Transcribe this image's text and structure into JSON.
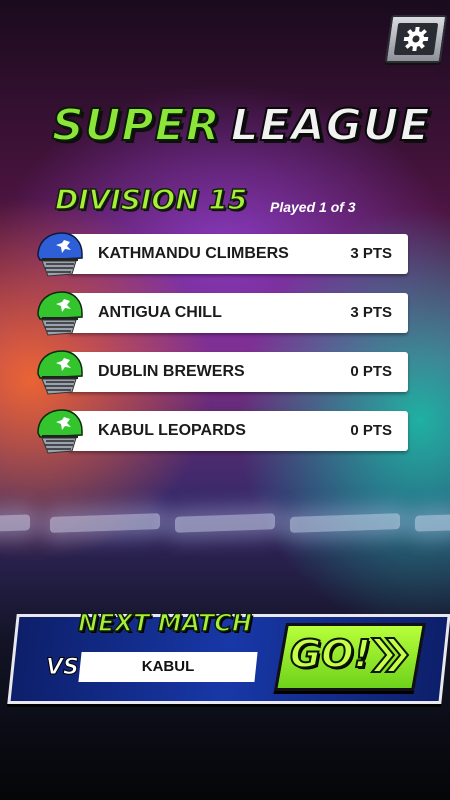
{
  "header": {
    "title_word1": "SUPER",
    "title_word2": "LEAGUE",
    "settings_icon": "gear-icon"
  },
  "league": {
    "division": "DIVISION 15",
    "played": "Played 1 of 3",
    "teams": [
      {
        "name": "KATHMANDU CLIMBERS",
        "points": "3 PTS",
        "helmet_color": "#2f5fd6",
        "icon": "cricket-helmet-icon"
      },
      {
        "name": "ANTIGUA CHILL",
        "points": "3 PTS",
        "helmet_color": "#34c52e",
        "icon": "cricket-helmet-icon"
      },
      {
        "name": "DUBLIN BREWERS",
        "points": "0 PTS",
        "helmet_color": "#34c52e",
        "icon": "cricket-helmet-icon"
      },
      {
        "name": "KABUL LEOPARDS",
        "points": "0 PTS",
        "helmet_color": "#34c52e",
        "icon": "cricket-helmet-icon"
      }
    ]
  },
  "next_match": {
    "label": "NEXT MATCH",
    "vs": "VS",
    "opponent": "KABUL",
    "go_label": "GO!",
    "accent": "#a8ef3a"
  }
}
